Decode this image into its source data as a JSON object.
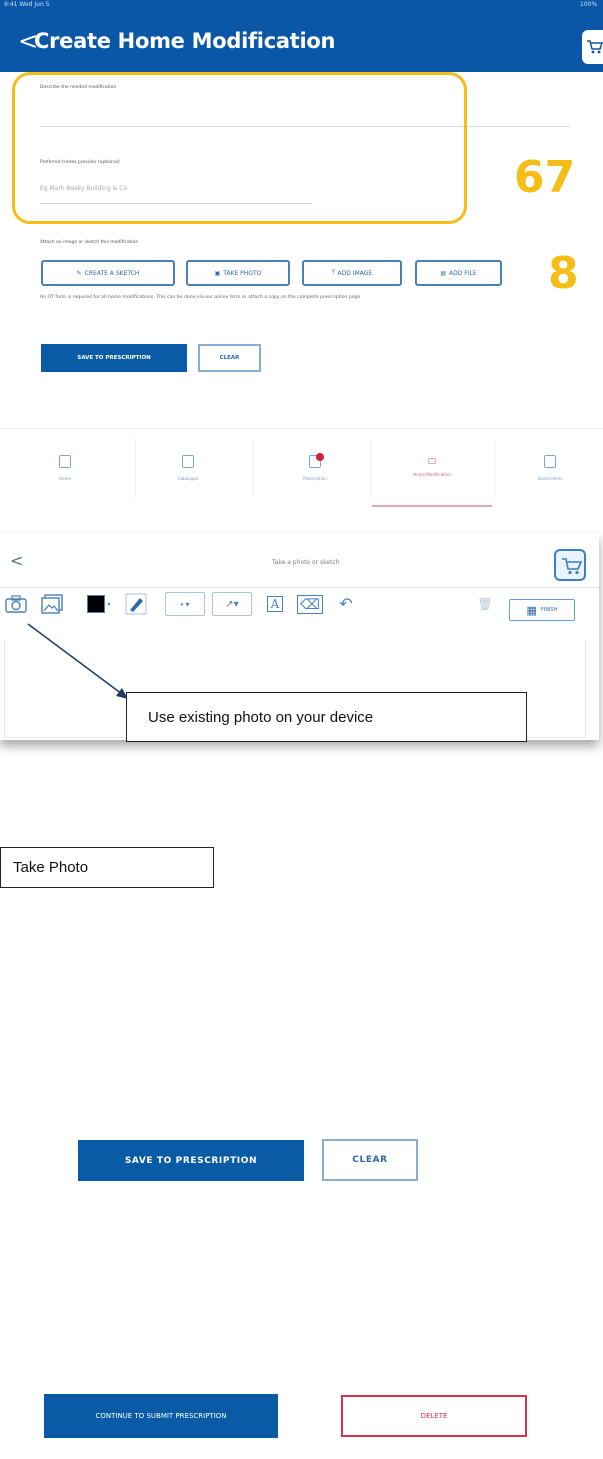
{
  "status_bar": {
    "left": "9:41 Wed Jun 5",
    "right": "100%"
  },
  "header": {
    "back_chevron": "<",
    "title": "Create Home Modification"
  },
  "form": {
    "describe_label": "Describe the needed modification",
    "preferred_label": "Preferred trades provider (optional)",
    "preferred_placeholder": "Eg Mark Beaky Building & Co",
    "attach_label": "Attach an image or sketch this modification",
    "note": "An OT form is required for all home modifications. This can be done via our online form or attach a copy on the complete prescription page"
  },
  "annotations": {
    "callout_67": "67",
    "callout_8": "8"
  },
  "attach_buttons": [
    {
      "icon": "pencil-icon",
      "label": "CREATE A SKETCH"
    },
    {
      "icon": "camera-icon",
      "label": "TAKE PHOTO"
    },
    {
      "icon": "upload-icon",
      "label": "ADD IMAGE"
    },
    {
      "icon": "file-icon",
      "label": "ADD FILE"
    }
  ],
  "actions_top": {
    "save": "SAVE TO PRESCRIPTION",
    "clear": "CLEAR"
  },
  "tabs": [
    {
      "icon": "home-icon",
      "label": "Home"
    },
    {
      "icon": "catalogue-icon",
      "label": "Catalogue"
    },
    {
      "icon": "prescription-icon",
      "label": "Prescription"
    },
    {
      "icon": "home-modification-icon",
      "label": "Home Modification"
    },
    {
      "icon": "saved-items-icon",
      "label": "Saved items"
    }
  ],
  "sketch_panel": {
    "back": "<",
    "title": "Take a photo or sketch",
    "finish": "FINISH",
    "tools": [
      "camera-icon",
      "gallery-icon",
      "color-swatch-icon",
      "pen-icon",
      "line-style-icon",
      "line-tool-icon",
      "text-icon",
      "eraser-icon",
      "undo-icon",
      "delete-icon"
    ]
  },
  "callouts": {
    "existing_photo": "Use existing photo on your device",
    "take_photo": "Take Photo"
  },
  "actions_middle": {
    "save": "SAVE TO PRESCRIPTION",
    "clear": "CLEAR"
  },
  "actions_bottom": {
    "continue": "CONTINUE TO SUBMIT PRESCRIPTION",
    "delete": "DELETE"
  },
  "colors": {
    "brand_blue": "#0a57a8",
    "highlight": "#f5bd16",
    "delete_red": "#d9344d"
  }
}
